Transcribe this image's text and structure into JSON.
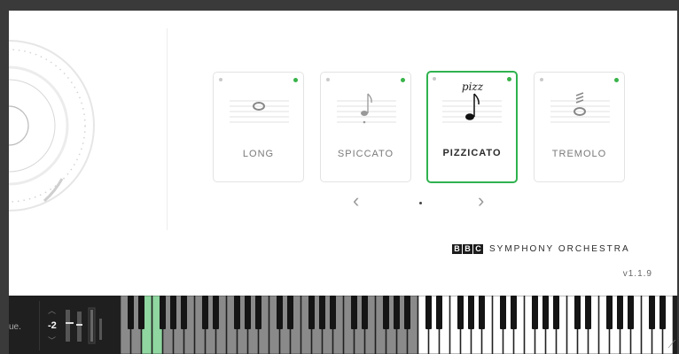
{
  "articulations": [
    {
      "label": "LONG",
      "selected": false,
      "marking": ""
    },
    {
      "label": "SPICCATO",
      "selected": false,
      "marking": ""
    },
    {
      "label": "PIZZICATO",
      "selected": true,
      "marking": "pizz"
    },
    {
      "label": "TREMOLO",
      "selected": false,
      "marking": ""
    }
  ],
  "navigation": {
    "prev_icon": "chevron-left-icon",
    "next_icon": "chevron-right-icon",
    "prev_glyph": "‹",
    "next_glyph": "›"
  },
  "brand": {
    "logo_letters": [
      "B",
      "B",
      "C"
    ],
    "name": "SYMPHONY ORCHESTRA"
  },
  "version": "v1.1.9",
  "bottom_bar": {
    "left_label": "ue.",
    "octave_value": "-2",
    "up_glyph": "︿",
    "down_glyph": "﹀"
  },
  "keyboard": {
    "highlighted_white_keys": [
      2,
      3
    ],
    "active_range_start_white_key": 28
  },
  "colors": {
    "accent": "#2fb24f",
    "highlight_key": "#8fd6a0",
    "inactive_key": "#8a8a8a"
  }
}
